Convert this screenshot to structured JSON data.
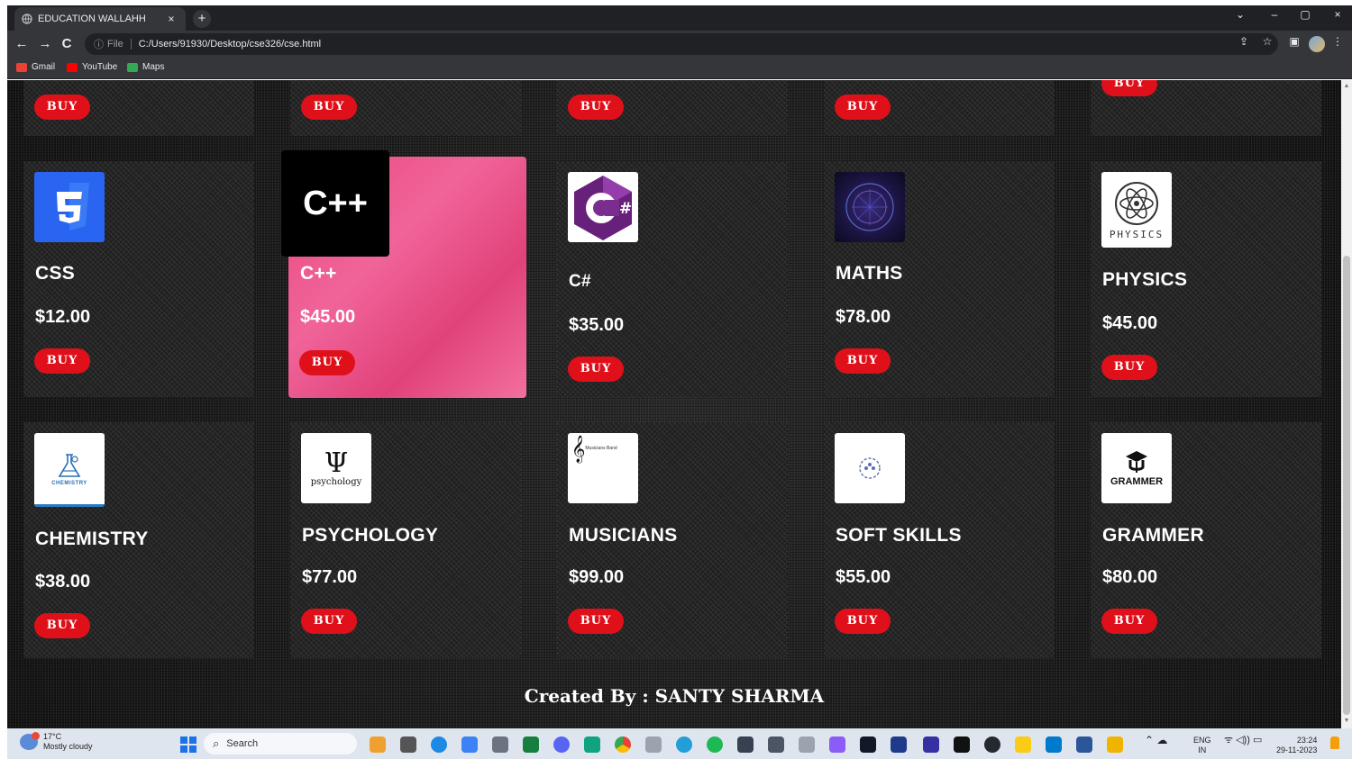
{
  "browser": {
    "tab_title": "EDUCATION WALLAHH",
    "tab_close": "×",
    "new_tab": "+",
    "window_controls": [
      "⌄",
      "–",
      "▢",
      "×"
    ],
    "nav": {
      "back": "←",
      "forward": "→",
      "reload": "C"
    },
    "address": {
      "info_icon": "ⓘ",
      "scheme": "File",
      "url": "C:/Users/91930/Desktop/cse326/cse.html"
    },
    "address_right_icons": [
      "share-icon",
      "star-icon",
      "sidepanel-icon",
      "profile-avatar",
      "menu-icon"
    ],
    "bookmarks": [
      {
        "label": "Gmail",
        "color": "#ea4335"
      },
      {
        "label": "YouTube",
        "color": "#ff0000"
      },
      {
        "label": "Maps",
        "color": "#34a853"
      }
    ]
  },
  "page": {
    "buy_label": "BUY",
    "accent_color": "#e0101a",
    "top_row_buy_count": 5,
    "courses_row1": [
      {
        "name": "CSS",
        "price": "$12.00",
        "logo": "css3-icon"
      },
      {
        "name": "C++",
        "price": "$45.00",
        "logo_text": "C++"
      },
      {
        "name": "C#",
        "price": "$35.00",
        "logo": "csharp-icon"
      },
      {
        "name": "MATHS",
        "price": "$78.00",
        "logo": "maths-icon"
      },
      {
        "name": "PHYSICS",
        "price": "$45.00",
        "logo_text": "PHYSICS"
      }
    ],
    "courses_row2": [
      {
        "name": "CHEMISTRY",
        "price": "$38.00",
        "logo_text": "CHEMISTRY"
      },
      {
        "name": "PSYCHOLOGY",
        "price": "$77.00",
        "logo_text": "psychology",
        "symbol": "Ψ"
      },
      {
        "name": "MUSICIANS",
        "price": "$99.00",
        "logo_text": "Musicians Band",
        "symbol": "𝄞"
      },
      {
        "name": "SOFT SKILLS",
        "price": "$55.00",
        "logo": "soft-skills-icon"
      },
      {
        "name": "GRAMMER",
        "price": "$80.00",
        "logo_text": "GRAMMER"
      }
    ],
    "footer": "Created By : SANTY SHARMA"
  },
  "taskbar": {
    "weather_temp": "17°C",
    "weather_desc": "Mostly cloudy",
    "search_label": "Search",
    "search_icon": "⌕",
    "lang_top": "ENG",
    "lang_bottom": "IN",
    "time": "23:24",
    "date": "29-11-2023",
    "tray_icons": "⌃  ☁",
    "tray_status": "ᯤ ◁)) ▭"
  }
}
